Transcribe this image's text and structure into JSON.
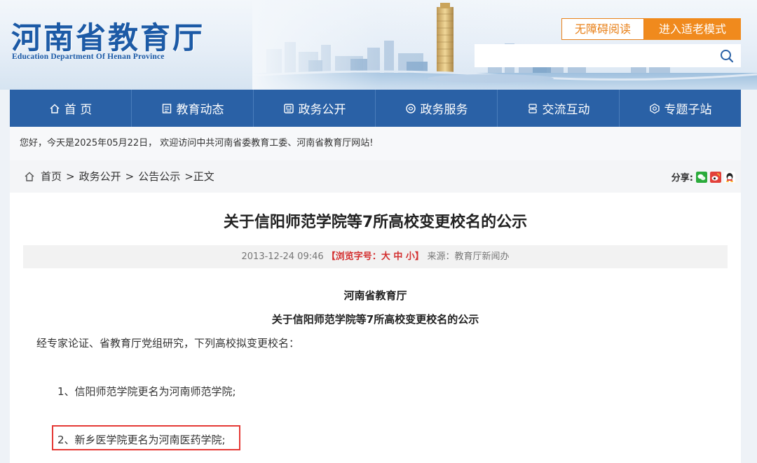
{
  "site": {
    "name_cn": "河南省教育厅",
    "name_en": "Education Department Of Henan Province"
  },
  "topbar": {
    "accessible_label": "无障碍阅读",
    "elder_mode_label": "进入适老模式",
    "search_placeholder": ""
  },
  "nav": {
    "items": [
      {
        "label": "首 页",
        "icon": "home-icon"
      },
      {
        "label": "教育动态",
        "icon": "news-icon"
      },
      {
        "label": "政务公开",
        "icon": "document-icon"
      },
      {
        "label": "政务服务",
        "icon": "service-icon"
      },
      {
        "label": "交流互动",
        "icon": "interaction-icon"
      },
      {
        "label": "专题子站",
        "icon": "topic-icon"
      }
    ]
  },
  "welcome": {
    "text": "您好，今天是2025年05月22日， 欢迎访问中共河南省委教育工委、河南省教育厅网站!"
  },
  "breadcrumb": {
    "items": [
      "首页",
      "政务公开",
      "公告公示"
    ],
    "separator": ">",
    "current": ">正文"
  },
  "share": {
    "label": "分享:",
    "icons": [
      "wechat-icon",
      "weibo-icon",
      "qq-icon"
    ],
    "colors": {
      "wechat": "#2bab3b",
      "weibo": "#e2403a",
      "qq": "#222222"
    }
  },
  "article": {
    "title": "关于信阳师范学院等7所高校变更校名的公示",
    "meta": {
      "date": "2013-12-24 09:46",
      "font_prefix": "【浏览字号：",
      "font_large": "大",
      "font_medium": "中",
      "font_small": "小",
      "font_suffix": "】",
      "source": "来源：教育厅新闻办"
    },
    "issuer": "河南省教育厅",
    "subtitle": "关于信阳师范学院等7所高校变更校名的公示",
    "intro": "经专家论证、省教育厅党组研究，下列高校拟变更校名：",
    "items": [
      "1、信阳师范学院更名为河南师范学院;",
      "2、新乡医学院更名为河南医药学院;"
    ]
  },
  "colors": {
    "brand_blue": "#1c5aa6",
    "nav_blue": "#2a61a6",
    "accent_orange": "#f08a1d",
    "highlight_red": "#e53935"
  }
}
